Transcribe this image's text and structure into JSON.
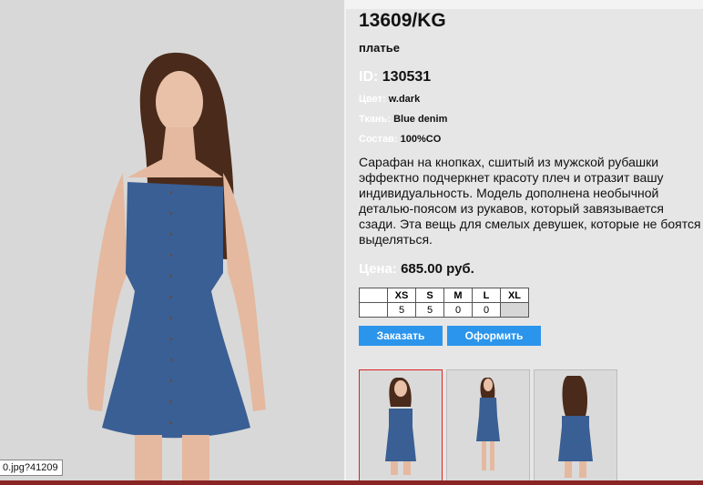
{
  "product": {
    "title": "13609/KG",
    "type": "платье",
    "id_label": "ID:",
    "id_value": "130531",
    "props": [
      {
        "label": "Цвет:",
        "value": "w.dark"
      },
      {
        "label": "Ткань:",
        "value": "Blue denim"
      },
      {
        "label": "Состав:",
        "value": "100%CO"
      }
    ],
    "description": "Сарафан на кнопках, сшитый из мужской рубашки эффектно подчеркнет красоту плеч и отразит вашу индивидуальность. Модель дополнена необычной деталью-поясом из рукавов, который завязывается сзади. Эта вещь для смелых девушек, которые не боятся выделяться.",
    "price_label": "Цена:",
    "price_value": "685.00 руб."
  },
  "sizes": {
    "headers": [
      "XS",
      "S",
      "M",
      "L",
      "XL"
    ],
    "quantities": [
      "5",
      "5",
      "0",
      "0",
      ""
    ]
  },
  "buttons": {
    "order": "Заказать",
    "checkout": "Оформить"
  },
  "tooltip": "0.jpg?41209",
  "colors": {
    "button": "#2b95ec",
    "active_thumb_border": "#dd2222",
    "label_white": "#ffffff",
    "bottom_bar": "#8a2525"
  }
}
